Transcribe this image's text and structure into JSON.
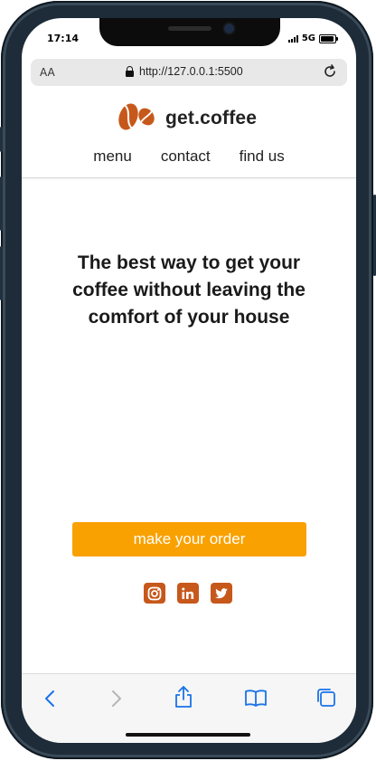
{
  "status_bar": {
    "time": "17:14",
    "network": "5G"
  },
  "browser": {
    "text_size_label": "AA",
    "url": "http://127.0.0.1:5500"
  },
  "site": {
    "brand": "get.coffee",
    "nav": [
      "menu",
      "contact",
      "find us"
    ],
    "headline": "The best way to get your coffee without leaving the comfort of your house",
    "cta_label": "make your order",
    "social_icons": [
      "instagram-icon",
      "linkedin-icon",
      "twitter-icon"
    ]
  },
  "colors": {
    "cta": "#f9a100",
    "social": "#c7581b",
    "logo": "#c7581b",
    "toolbar_icons": "#1a73e8"
  },
  "toolbar": [
    "back-icon",
    "forward-icon",
    "share-icon",
    "bookmarks-icon",
    "tabs-icon"
  ]
}
